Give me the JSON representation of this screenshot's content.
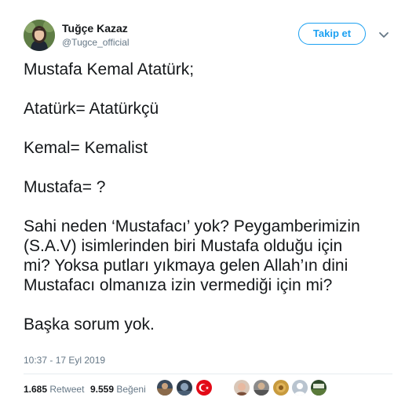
{
  "user": {
    "display_name": "Tuğçe Kazaz",
    "handle": "@Tugce_official"
  },
  "follow_label": "Takip et",
  "tweet": {
    "lines": [
      "Mustafa Kemal Atatürk;",
      "Atatürk= Atatürkçü",
      "Kemal= Kemalist",
      "Mustafa= ?",
      "Sahi neden ‘Mustafacı’ yok? Peygamberimizin",
      "(S.A.V) isimlerinden biri Mustafa olduğu için",
      "mi? Yoksa putları yıkmaya gelen Allah’ın dini",
      "Mustafacı olmanıza izin vermediği için mi?",
      "Başka sorum yok."
    ]
  },
  "timestamp": "10:37 - 17 Eyl 2019",
  "stats": {
    "retweets_count": "1.685",
    "retweets_label": "Retweet",
    "likes_count": "9.559",
    "likes_label": "Beğeni"
  },
  "colors": {
    "accent": "#1da1f2",
    "text": "#14171a",
    "secondary": "#657786"
  },
  "icons": [
    "chevron-down-icon"
  ]
}
